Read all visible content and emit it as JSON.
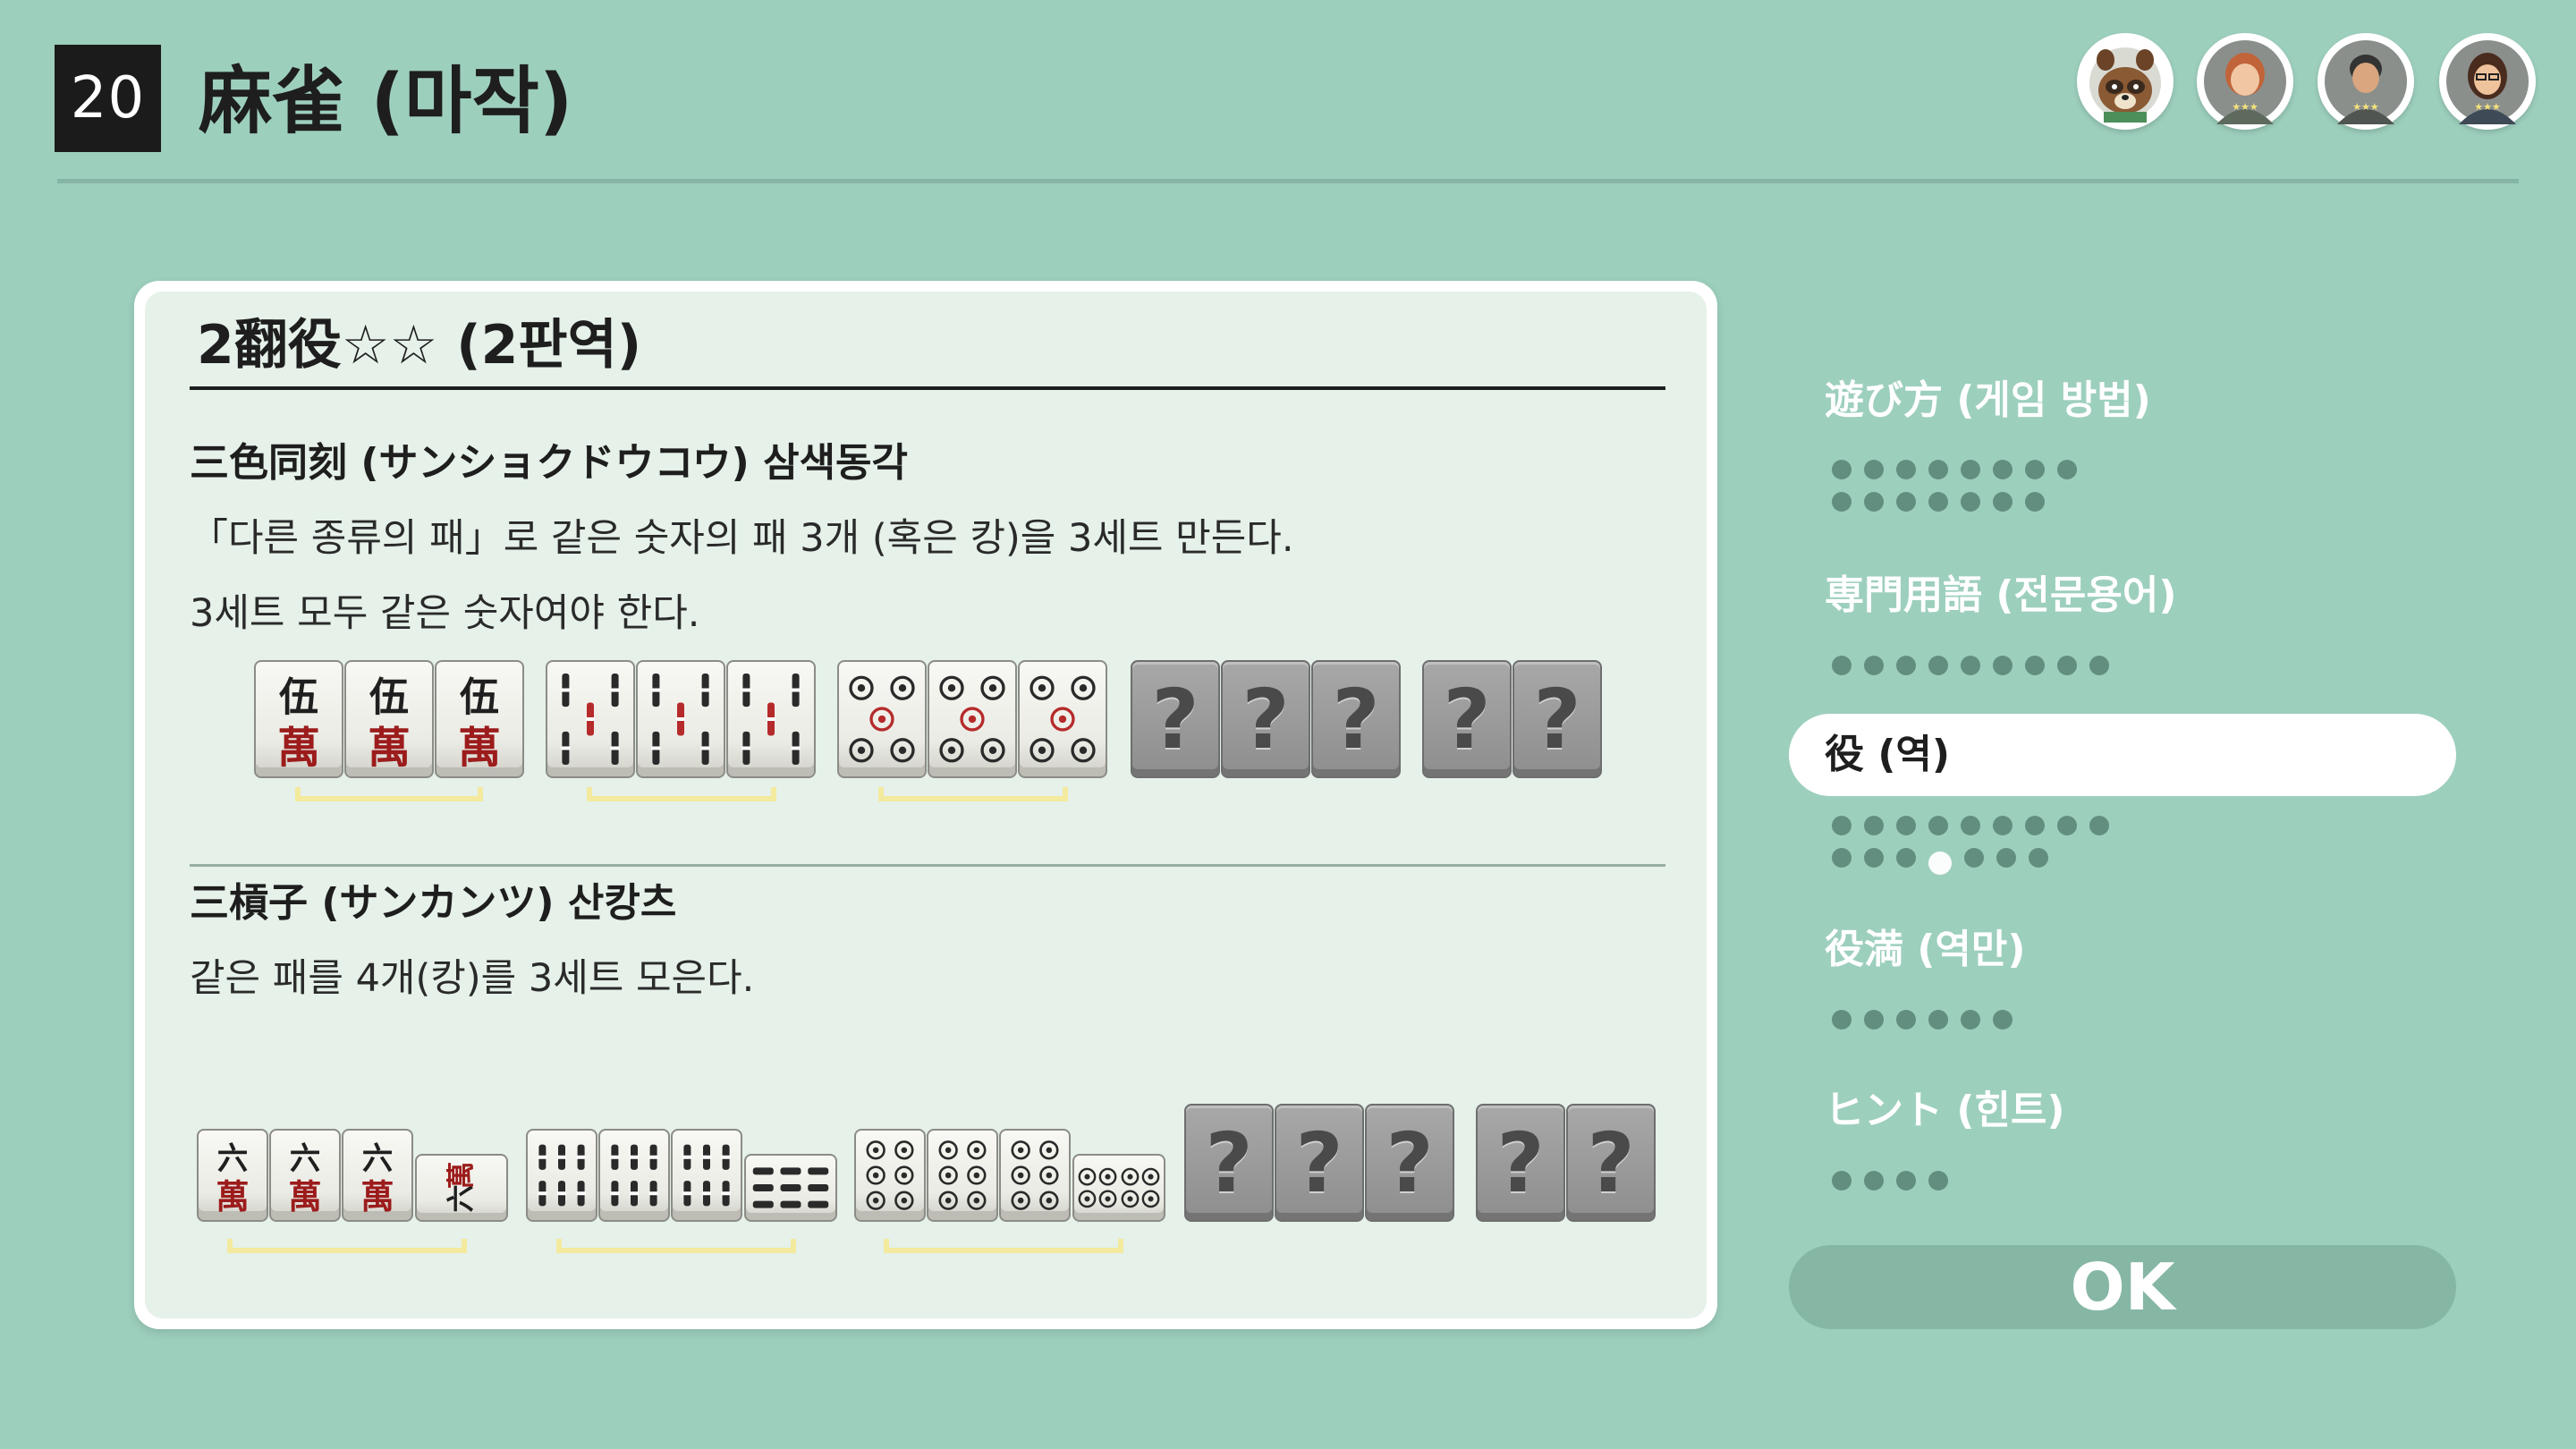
{
  "header": {
    "game_number": "20",
    "title": "麻雀 (마작)"
  },
  "card": {
    "section_title": "2翻役☆☆ (2판역)",
    "yaku": [
      {
        "name": "三色同刻 (サンショクドウコウ) 삼색동각",
        "lines": [
          "「다른 종류의 패」로 같은 숫자의 패 3개 (혹은 캉)을 3세트 만든다.",
          "3세트 모두 같은 숫자여야 한다."
        ]
      },
      {
        "name": "三槓子 (サンカンツ) 산캉츠",
        "lines": [
          "같은 패를 4개(캉)를 3세트 모은다."
        ]
      }
    ],
    "hidden_tile_glyph": "?",
    "tile_chars": {
      "man": "萬",
      "five": "伍",
      "six": "六"
    }
  },
  "menu": {
    "items": [
      {
        "label": "遊び方 (게임 방법)",
        "dots_row1": 8,
        "dots_row2": 7
      },
      {
        "label": "専門用語 (전문용어)",
        "dots_row1": 9,
        "dots_row2": 0
      },
      {
        "label": "役 (역)",
        "dots_row1": 9,
        "dots_row2": 7,
        "active": true
      },
      {
        "label": "役満 (역만)",
        "dots_row1": 6,
        "dots_row2": 0
      },
      {
        "label": "ヒント (힌트)",
        "dots_row1": 4,
        "dots_row2": 0
      }
    ],
    "ok_label": "OK"
  },
  "players": [
    "raccoon-avatar",
    "player-avatar-2",
    "player-avatar-3",
    "player-avatar-4"
  ],
  "colors": {
    "background": "#9dcfbd",
    "card_inner": "#e5f1e9",
    "bracket": "#f4ea9e",
    "man_red": "#9c1c1c"
  }
}
